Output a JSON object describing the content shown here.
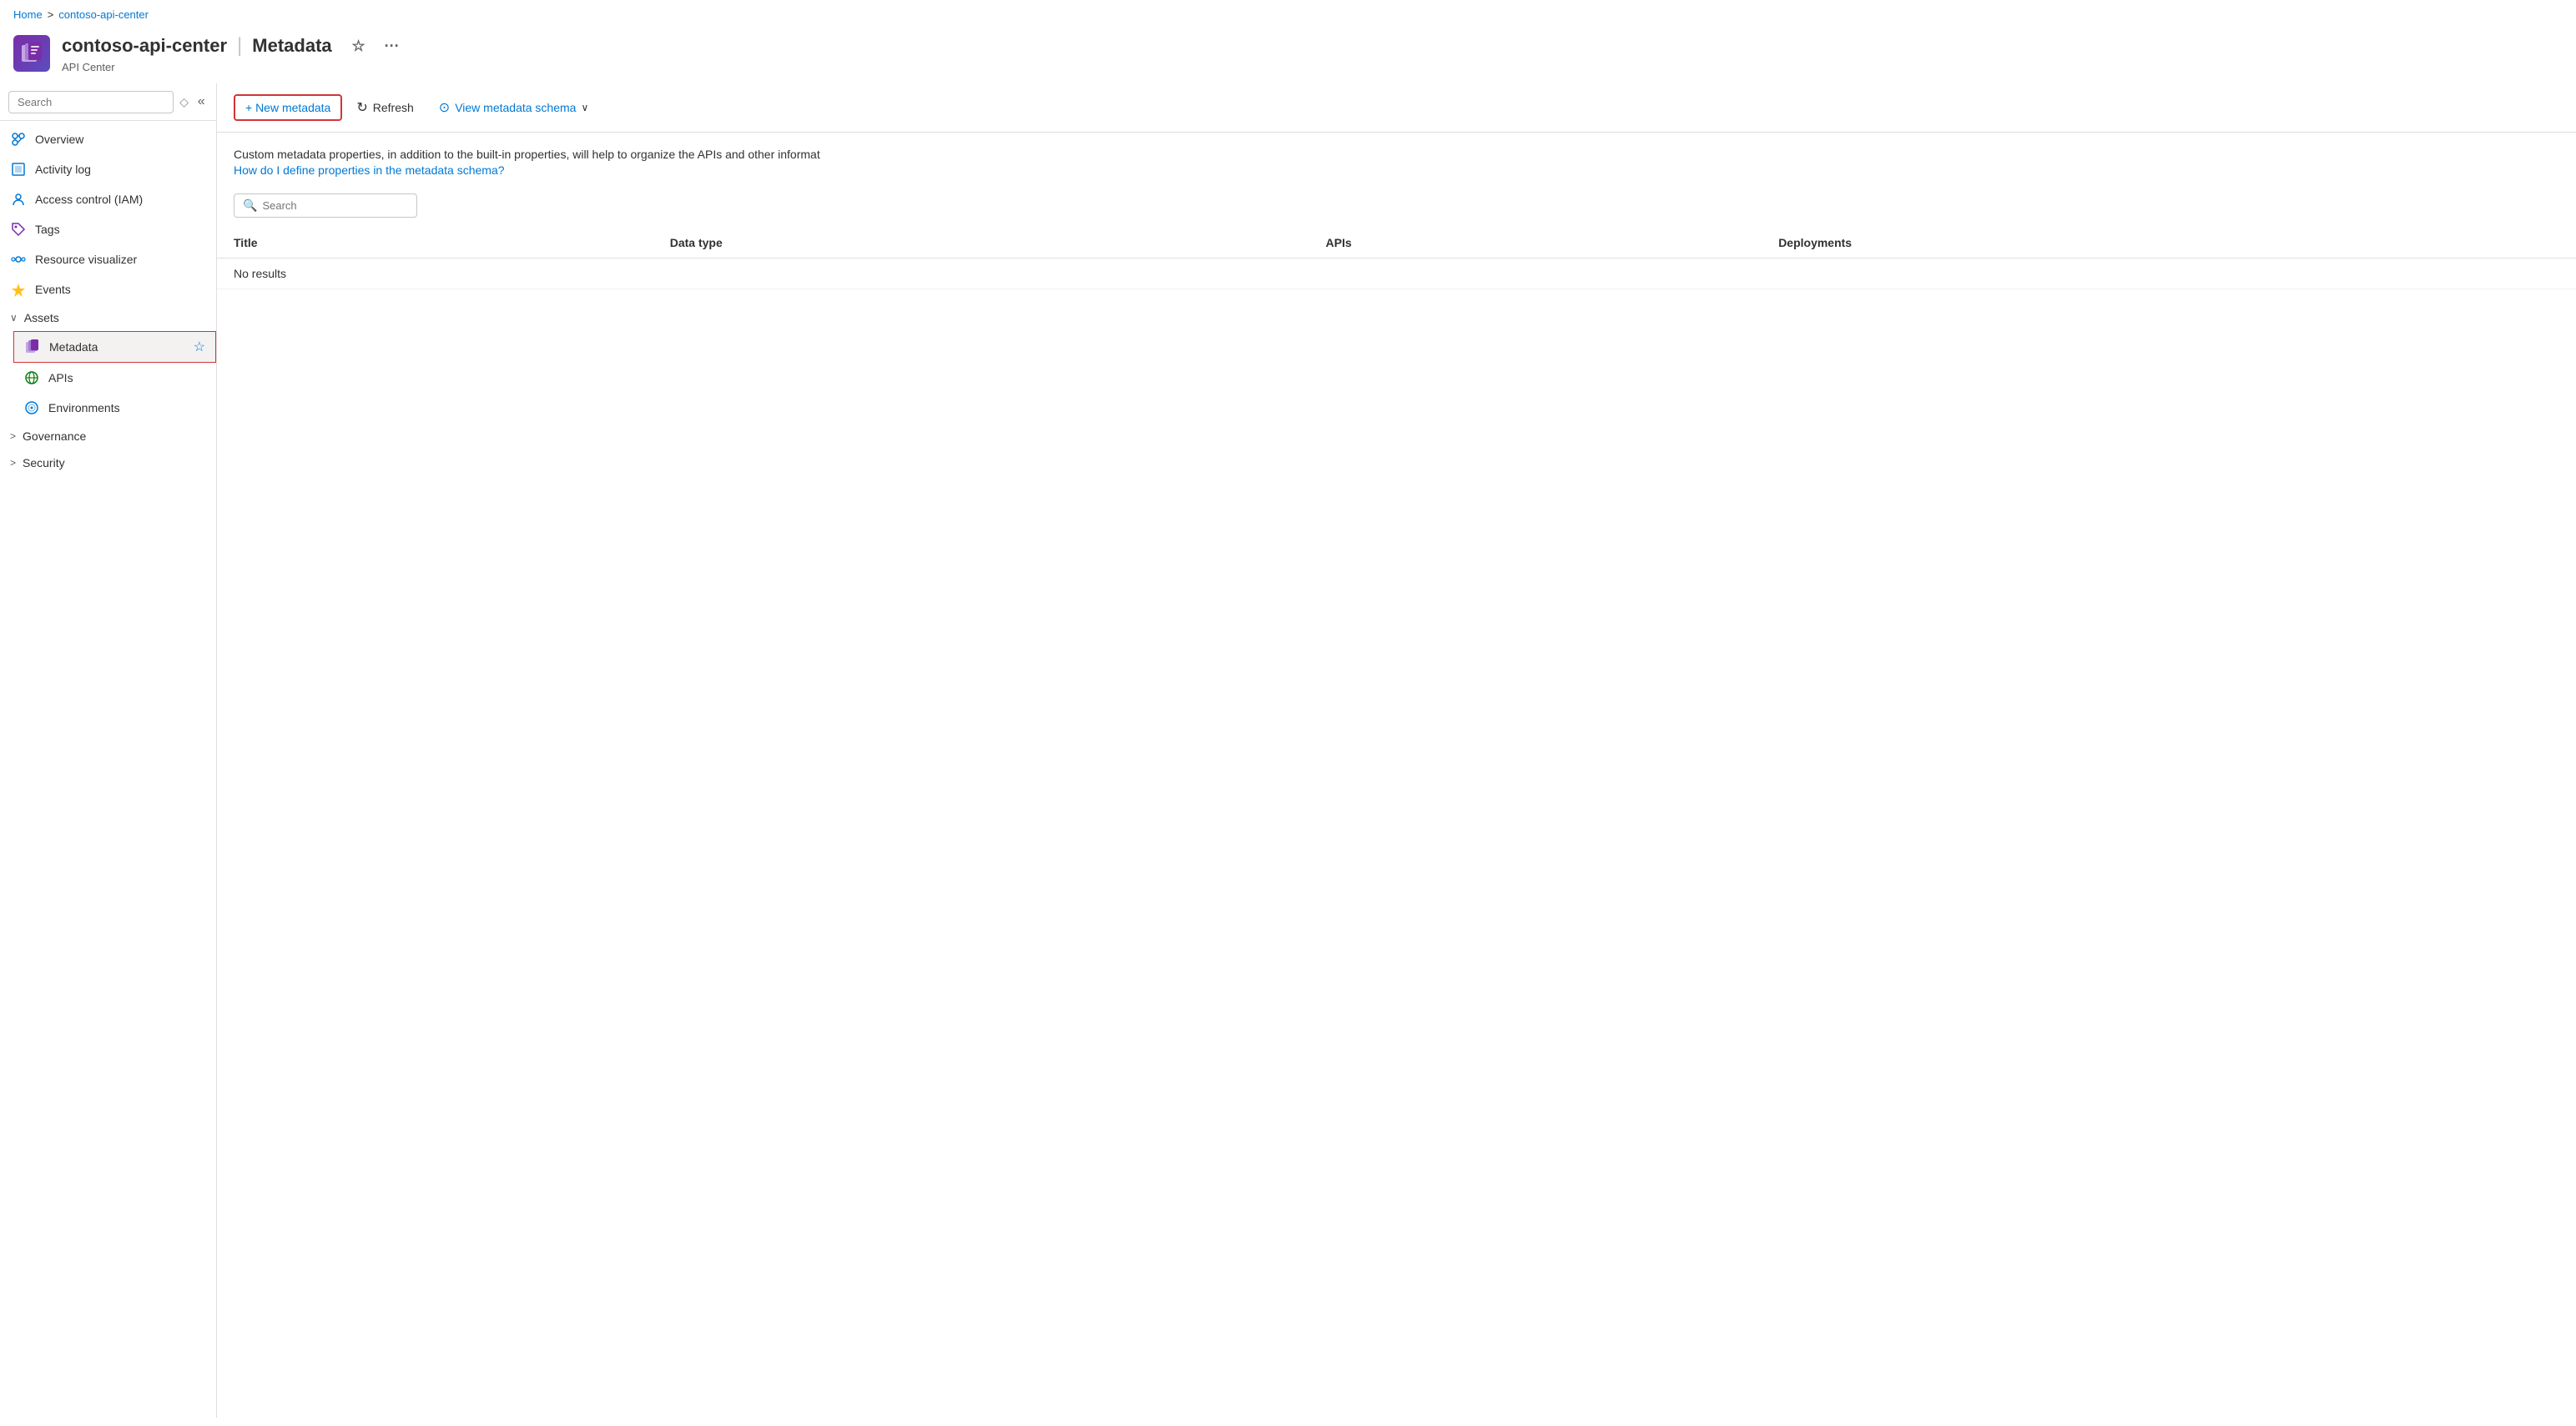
{
  "breadcrumb": {
    "home": "Home",
    "separator": ">",
    "current": "contoso-api-center"
  },
  "header": {
    "resource_name": "contoso-api-center",
    "separator": "|",
    "page_title": "Metadata",
    "subtitle": "API Center",
    "star_icon": "☆",
    "more_icon": "···"
  },
  "sidebar": {
    "search_placeholder": "Search",
    "collapse_icon": "«",
    "diamond_icon": "◇",
    "nav_items": [
      {
        "id": "overview",
        "label": "Overview",
        "icon": "overview"
      },
      {
        "id": "activity-log",
        "label": "Activity log",
        "icon": "activity"
      },
      {
        "id": "access-control",
        "label": "Access control (IAM)",
        "icon": "access"
      },
      {
        "id": "tags",
        "label": "Tags",
        "icon": "tags"
      },
      {
        "id": "resource-visualizer",
        "label": "Resource visualizer",
        "icon": "resource"
      },
      {
        "id": "events",
        "label": "Events",
        "icon": "events"
      }
    ],
    "assets_section": {
      "label": "Assets",
      "expanded": true,
      "children": [
        {
          "id": "metadata",
          "label": "Metadata",
          "active": true,
          "star": "☆"
        },
        {
          "id": "apis",
          "label": "APIs",
          "icon": "apis"
        },
        {
          "id": "environments",
          "label": "Environments",
          "icon": "environments"
        }
      ]
    },
    "governance_section": {
      "label": "Governance",
      "expanded": false
    },
    "security_section": {
      "label": "Security",
      "expanded": false
    }
  },
  "toolbar": {
    "new_metadata_label": "+ New metadata",
    "refresh_label": "Refresh",
    "view_schema_label": "View metadata schema",
    "view_schema_chevron": "∨"
  },
  "description": {
    "text": "Custom metadata properties, in addition to the built-in properties, will help to organize the APIs and other informat",
    "link_text": "How do I define properties in the metadata schema?"
  },
  "content_search": {
    "placeholder": "Search"
  },
  "table": {
    "columns": [
      "Title",
      "Data type",
      "APIs",
      "Deployments"
    ],
    "no_results": "No results"
  }
}
